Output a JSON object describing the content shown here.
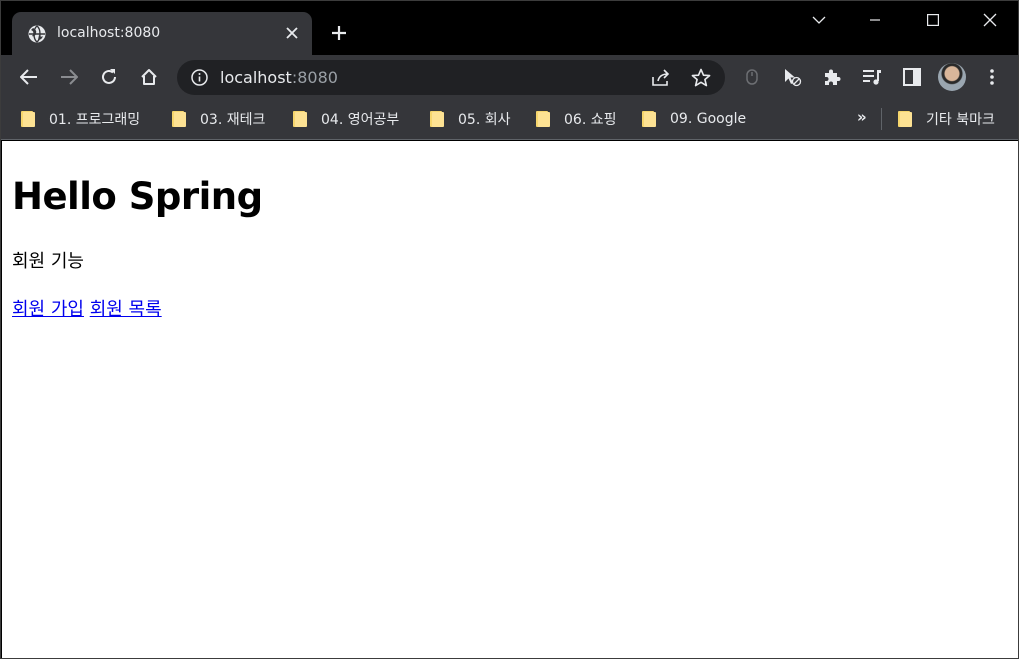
{
  "browser": {
    "tab": {
      "title": "localhost:8080"
    },
    "omnibox": {
      "host": "localhost",
      "port": ":8080"
    },
    "bookmarks": [
      {
        "label": "01. 프로그래밍"
      },
      {
        "label": "03. 재테크"
      },
      {
        "label": "04. 영어공부"
      },
      {
        "label": "05. 회사"
      },
      {
        "label": "06. 쇼핑"
      },
      {
        "label": "09. Google"
      }
    ],
    "bookmarks_overflow": "»",
    "other_bookmarks": "기타 북마크"
  },
  "page": {
    "heading": "Hello Spring",
    "subtitle": "회원 기능",
    "links": [
      {
        "label": "회원 가입"
      },
      {
        "label": "회원 목록"
      }
    ]
  },
  "colors": {
    "tab_bg": "#35363a",
    "omnibox_bg": "#202124",
    "link": "#0000ee",
    "folder": "#fde293"
  }
}
